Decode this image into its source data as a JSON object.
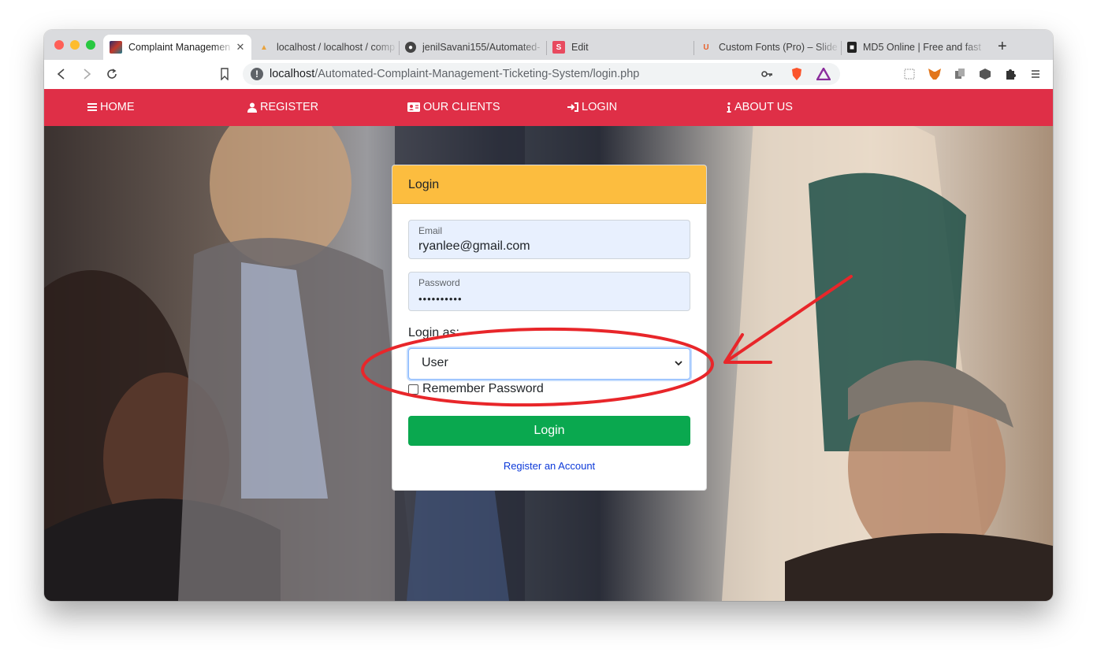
{
  "browser": {
    "tabs": [
      {
        "title": "Complaint Managemen",
        "active": true,
        "favicon": "app-favicon"
      },
      {
        "title": "localhost / localhost / comp",
        "favicon": "phpmyadmin-favicon"
      },
      {
        "title": "jenilSavani155/Automated-",
        "favicon": "github-favicon"
      },
      {
        "title": "Edit",
        "favicon": "slides-favicon"
      },
      {
        "title": "Custom Fonts (Pro) – Slide",
        "favicon": "fonts-favicon"
      },
      {
        "title": "MD5 Online | Free and fast",
        "favicon": "md5-favicon"
      }
    ],
    "new_tab": "+",
    "url_host": "localhost",
    "url_path": "/Automated-Complaint-Management-Ticketing-System/login.php"
  },
  "nav": {
    "items": [
      {
        "label": "HOME",
        "icon": "bars-icon"
      },
      {
        "label": "REGISTER",
        "icon": "user-icon"
      },
      {
        "label": "OUR CLIENTS",
        "icon": "id-card-icon"
      },
      {
        "label": "LOGIN",
        "icon": "sign-in-icon"
      },
      {
        "label": "ABOUT US",
        "icon": "info-icon"
      }
    ],
    "color": "#df2f47"
  },
  "login": {
    "title": "Login",
    "email_label": "Email",
    "email_value": "ryanlee@gmail.com",
    "password_label": "Password",
    "password_value": "••••••••••",
    "login_as_label": "Login as:",
    "login_as_value": "User",
    "remember_label": "Remember Password",
    "button_label": "Login",
    "register_link": "Register an Account",
    "header_color": "#fcbd3f",
    "button_color": "#0aa84f"
  },
  "annotation": {
    "color": "#e8262a"
  }
}
